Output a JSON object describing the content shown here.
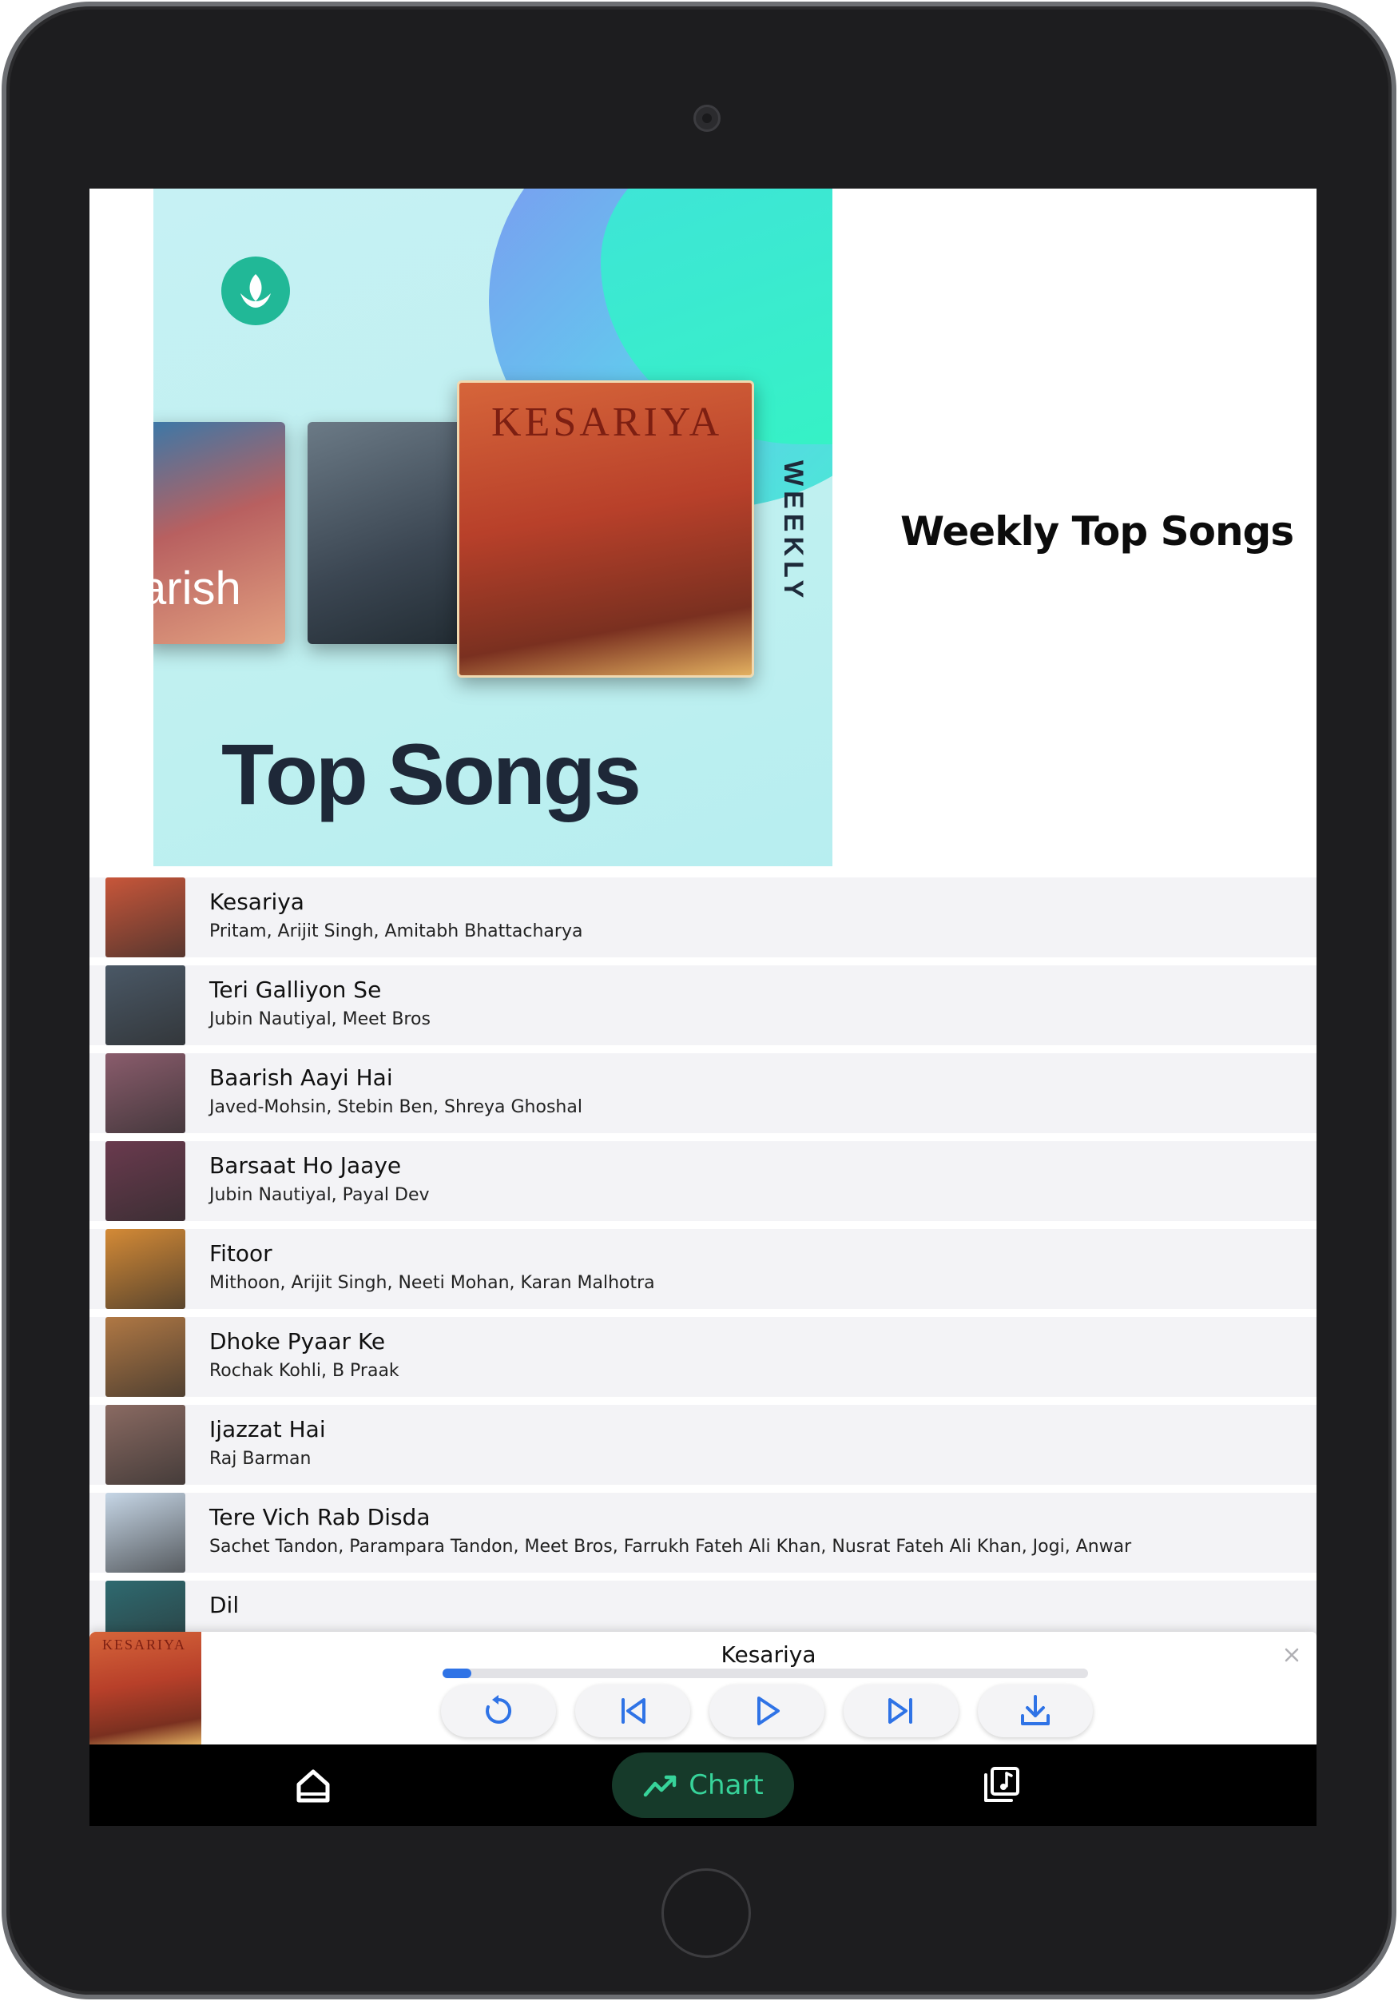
{
  "header": {
    "cover_title": "Top Songs",
    "cover_vertical_label": "WEEKLY",
    "cover_art_label": "KESARIYA",
    "cover_side_label": "arish",
    "title": "Weekly Top Songs"
  },
  "songs": [
    {
      "title": "Kesariya",
      "artists": "Pritam, Arijit Singh, Amitabh Bhattacharya",
      "thumb": "#c8563a"
    },
    {
      "title": "Teri Galliyon Se",
      "artists": "Jubin Nautiyal, Meet Bros",
      "thumb": "#4a5866"
    },
    {
      "title": "Baarish Aayi Hai",
      "artists": "Javed-Mohsin, Stebin Ben, Shreya Ghoshal",
      "thumb": "#8a5c6c"
    },
    {
      "title": "Barsaat Ho Jaaye",
      "artists": "Jubin Nautiyal, Payal Dev",
      "thumb": "#6a3a4e"
    },
    {
      "title": "Fitoor",
      "artists": "Mithoon, Arijit Singh, Neeti Mohan, Karan Malhotra",
      "thumb": "#d48a36"
    },
    {
      "title": "Dhoke Pyaar Ke",
      "artists": "Rochak Kohli, B Praak",
      "thumb": "#b07844"
    },
    {
      "title": "Ijazzat Hai",
      "artists": "Raj Barman",
      "thumb": "#8a6a62"
    },
    {
      "title": "Tere Vich Rab Disda",
      "artists": "Sachet Tandon, Parampara Tandon, Meet Bros, Farrukh Fateh Ali Khan, Nusrat Fateh Ali Khan, Jogi, Anwar",
      "thumb": "#c6d6e6"
    },
    {
      "title": "Dil",
      "artists": "",
      "thumb": "#2e6a70"
    }
  ],
  "player": {
    "now_playing": "Kesariya",
    "art_label": "KESARIYA",
    "progress": 0.045,
    "controls": [
      "replay-icon",
      "previous-icon",
      "play-icon",
      "next-icon",
      "download-icon"
    ]
  },
  "nav": {
    "chart_label": "Chart",
    "accent": "#37d39a"
  }
}
